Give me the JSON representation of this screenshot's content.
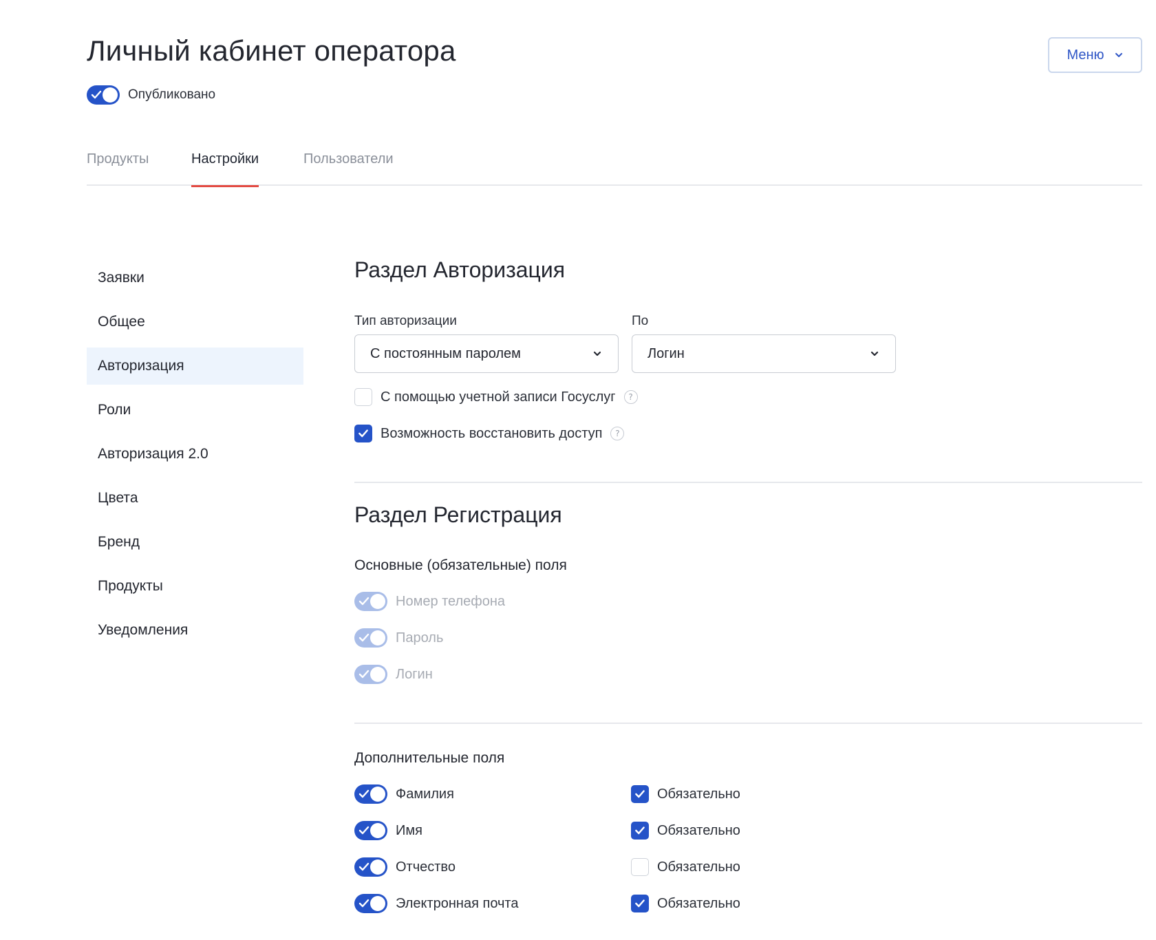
{
  "header": {
    "title": "Личный кабинет оператора",
    "menu_label": "Меню",
    "published_label": "Опубликовано",
    "published": true
  },
  "tabs": [
    {
      "label": "Продукты",
      "active": false
    },
    {
      "label": "Настройки",
      "active": true
    },
    {
      "label": "Пользователи",
      "active": false
    }
  ],
  "sidebar": {
    "items": [
      {
        "label": "Заявки",
        "active": false
      },
      {
        "label": "Общее",
        "active": false
      },
      {
        "label": "Авторизация",
        "active": true
      },
      {
        "label": "Роли",
        "active": false
      },
      {
        "label": "Авторизация 2.0",
        "active": false
      },
      {
        "label": "Цвета",
        "active": false
      },
      {
        "label": "Бренд",
        "active": false
      },
      {
        "label": "Продукты",
        "active": false
      },
      {
        "label": "Уведомления",
        "active": false
      }
    ]
  },
  "auth_section": {
    "title": "Раздел Авторизация",
    "auth_type_label": "Тип авторизации",
    "auth_type_value": "С постоянным паролем",
    "by_label": "По",
    "by_value": "Логин",
    "gosuslugi_label": "С помощью учетной записи Госуслуг",
    "gosuslugi_checked": false,
    "recovery_label": "Возможность восстановить доступ",
    "recovery_checked": true,
    "help_glyph": "?"
  },
  "registration_section": {
    "title": "Раздел Регистрация",
    "required_fields_title": "Основные (обязательные) поля",
    "required_fields": [
      {
        "label": "Номер телефона",
        "enabled": true
      },
      {
        "label": "Пароль",
        "enabled": true
      },
      {
        "label": "Логин",
        "enabled": true
      }
    ],
    "extra_fields_title": "Дополнительные поля",
    "required_label": "Обязательно",
    "extra_fields": [
      {
        "label": "Фамилия",
        "enabled": true,
        "required": true
      },
      {
        "label": "Имя",
        "enabled": true,
        "required": true
      },
      {
        "label": "Отчество",
        "enabled": true,
        "required": false
      },
      {
        "label": "Электронная почта",
        "enabled": true,
        "required": true
      }
    ]
  },
  "colors": {
    "accent": "#2553c8",
    "accent_disabled": "#a9bde8",
    "tab_indicator": "#e34b43",
    "active_nav_bg": "#edf4fd"
  }
}
